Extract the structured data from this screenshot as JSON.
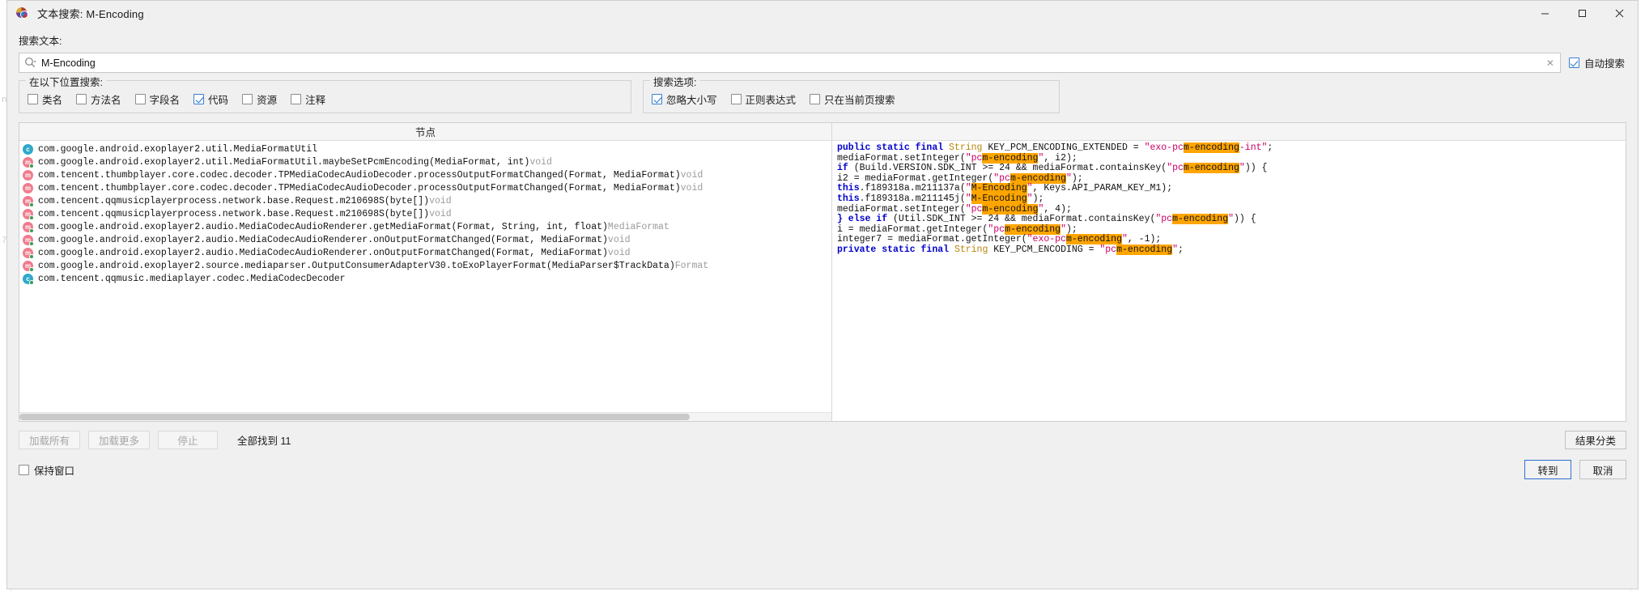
{
  "window": {
    "title": "文本搜索: M-Encoding",
    "icon": "jadx-app-icon",
    "controls": {
      "minimize": "minimize-icon",
      "maximize": "maximize-icon",
      "close": "close-icon"
    }
  },
  "search": {
    "label": "搜索文本:",
    "value": "M-Encoding",
    "icon": "search-icon",
    "clear_icon": "clear-icon",
    "auto_search_label": "自动搜索",
    "auto_search_checked": true
  },
  "locations": {
    "legend": "在以下位置搜索:",
    "items": [
      {
        "label": "类名",
        "checked": false
      },
      {
        "label": "方法名",
        "checked": false
      },
      {
        "label": "字段名",
        "checked": false
      },
      {
        "label": "代码",
        "checked": true
      },
      {
        "label": "资源",
        "checked": false
      },
      {
        "label": "注释",
        "checked": false
      }
    ]
  },
  "options": {
    "legend": "搜索选项:",
    "items": [
      {
        "label": "忽略大小写",
        "checked": true
      },
      {
        "label": "正则表达式",
        "checked": false
      },
      {
        "label": "只在当前页搜索",
        "checked": false
      }
    ]
  },
  "results": {
    "node_column_header": "节点",
    "code_column_header": "",
    "rows": [
      {
        "icon": "class-icon",
        "kind": "class",
        "badge": "none",
        "text": "com.google.android.exoplayer2.util.MediaFormatUtil",
        "ret": ""
      },
      {
        "icon": "method-icon",
        "kind": "method",
        "badge": "green",
        "text": "com.google.android.exoplayer2.util.MediaFormatUtil.maybeSetPcmEncoding(MediaFormat, int)",
        "ret": "void"
      },
      {
        "icon": "method-icon",
        "kind": "method",
        "badge": "none",
        "text": "com.tencent.thumbplayer.core.codec.decoder.TPMediaCodecAudioDecoder.processOutputFormatChanged(Format, MediaFormat)",
        "ret": "void"
      },
      {
        "icon": "method-icon",
        "kind": "method",
        "badge": "none",
        "text": "com.tencent.thumbplayer.core.codec.decoder.TPMediaCodecAudioDecoder.processOutputFormatChanged(Format, MediaFormat)",
        "ret": "void"
      },
      {
        "icon": "method-icon",
        "kind": "method",
        "badge": "green",
        "text": "com.tencent.qqmusicplayerprocess.network.base.Request.m210698S(byte[])",
        "ret": "void"
      },
      {
        "icon": "method-icon",
        "kind": "method",
        "badge": "green",
        "text": "com.tencent.qqmusicplayerprocess.network.base.Request.m210698S(byte[])",
        "ret": "void"
      },
      {
        "icon": "method-icon",
        "kind": "method",
        "badge": "green",
        "text": "com.google.android.exoplayer2.audio.MediaCodecAudioRenderer.getMediaFormat(Format, String, int, float)",
        "ret": "MediaFormat"
      },
      {
        "icon": "method-icon",
        "kind": "method",
        "badge": "green",
        "text": "com.google.android.exoplayer2.audio.MediaCodecAudioRenderer.onOutputFormatChanged(Format, MediaFormat)",
        "ret": "void"
      },
      {
        "icon": "method-icon",
        "kind": "method",
        "badge": "green",
        "text": "com.google.android.exoplayer2.audio.MediaCodecAudioRenderer.onOutputFormatChanged(Format, MediaFormat)",
        "ret": "void"
      },
      {
        "icon": "method-icon",
        "kind": "method",
        "badge": "green",
        "text": "com.google.android.exoplayer2.source.mediaparser.OutputConsumerAdapterV30.toExoPlayerFormat(MediaParser$TrackData)",
        "ret": "Format"
      },
      {
        "icon": "class-icon",
        "kind": "class",
        "badge": "green",
        "text": "com.tencent.qqmusic.mediaplayer.codec.MediaCodecDecoder",
        "ret": ""
      }
    ],
    "code_lines": [
      [
        {
          "t": "public static final ",
          "c": "kw"
        },
        {
          "t": "String ",
          "c": "typ"
        },
        {
          "t": "KEY_PCM_ENCODING_EXTENDED = ",
          "c": "pln"
        },
        {
          "t": "\"exo-pc",
          "c": "str"
        },
        {
          "t": "m-encoding",
          "c": "hl"
        },
        {
          "t": "-int\"",
          "c": "str"
        },
        {
          "t": ";",
          "c": "pln"
        }
      ],
      [
        {
          "t": "mediaFormat.setInteger(",
          "c": "pln"
        },
        {
          "t": "\"pc",
          "c": "str"
        },
        {
          "t": "m-encoding",
          "c": "hl"
        },
        {
          "t": "\"",
          "c": "str"
        },
        {
          "t": ", i2);",
          "c": "pln"
        }
      ],
      [
        {
          "t": "if ",
          "c": "kw"
        },
        {
          "t": "(Build.VERSION.SDK_INT >= 24 && mediaFormat.containsKey(",
          "c": "pln"
        },
        {
          "t": "\"pc",
          "c": "str"
        },
        {
          "t": "m-encoding",
          "c": "hl"
        },
        {
          "t": "\"",
          "c": "str"
        },
        {
          "t": ")) {",
          "c": "pln"
        }
      ],
      [
        {
          "t": "i2 = mediaFormat.getInteger(",
          "c": "pln"
        },
        {
          "t": "\"pc",
          "c": "str"
        },
        {
          "t": "m-encoding",
          "c": "hl"
        },
        {
          "t": "\"",
          "c": "str"
        },
        {
          "t": ");",
          "c": "pln"
        }
      ],
      [
        {
          "t": "this",
          "c": "kw"
        },
        {
          "t": ".f189318a.m211137a(",
          "c": "pln"
        },
        {
          "t": "\"",
          "c": "str"
        },
        {
          "t": "M-Encoding",
          "c": "hl"
        },
        {
          "t": "\"",
          "c": "str"
        },
        {
          "t": ", Keys.API_PARAM_KEY_M1);",
          "c": "pln"
        }
      ],
      [
        {
          "t": "this",
          "c": "kw"
        },
        {
          "t": ".f189318a.m211145j(",
          "c": "pln"
        },
        {
          "t": "\"",
          "c": "str"
        },
        {
          "t": "M-Encoding",
          "c": "hl"
        },
        {
          "t": "\"",
          "c": "str"
        },
        {
          "t": ");",
          "c": "pln"
        }
      ],
      [
        {
          "t": "mediaFormat.setInteger(",
          "c": "pln"
        },
        {
          "t": "\"pc",
          "c": "str"
        },
        {
          "t": "m-encoding",
          "c": "hl"
        },
        {
          "t": "\"",
          "c": "str"
        },
        {
          "t": ", 4);",
          "c": "pln"
        }
      ],
      [
        {
          "t": "} else if ",
          "c": "kw"
        },
        {
          "t": "(Util.SDK_INT >= 24 && mediaFormat.containsKey(",
          "c": "pln"
        },
        {
          "t": "\"pc",
          "c": "str"
        },
        {
          "t": "m-encoding",
          "c": "hl"
        },
        {
          "t": "\"",
          "c": "str"
        },
        {
          "t": ")) {",
          "c": "pln"
        }
      ],
      [
        {
          "t": "i = mediaFormat.getInteger(",
          "c": "pln"
        },
        {
          "t": "\"pc",
          "c": "str"
        },
        {
          "t": "m-encoding",
          "c": "hl"
        },
        {
          "t": "\"",
          "c": "str"
        },
        {
          "t": ");",
          "c": "pln"
        }
      ],
      [
        {
          "t": "integer7 = mediaFormat.getInteger(",
          "c": "pln"
        },
        {
          "t": "\"exo-pc",
          "c": "str"
        },
        {
          "t": "m-encoding",
          "c": "hl"
        },
        {
          "t": "\"",
          "c": "str"
        },
        {
          "t": ", -1);",
          "c": "pln"
        }
      ],
      [
        {
          "t": "private static final ",
          "c": "kw"
        },
        {
          "t": "String ",
          "c": "typ"
        },
        {
          "t": "KEY_PCM_ENCODING = ",
          "c": "pln"
        },
        {
          "t": "\"pc",
          "c": "str"
        },
        {
          "t": "m-encoding",
          "c": "hl"
        },
        {
          "t": "\"",
          "c": "str"
        },
        {
          "t": ";",
          "c": "pln"
        }
      ]
    ]
  },
  "footer": {
    "load_all_label": "加载所有",
    "load_more_label": "加载更多",
    "stop_label": "停止",
    "found_label": "全部找到",
    "found_count": "11",
    "classify_label": "结果分类",
    "keep_window_label": "保持窗口",
    "keep_window_checked": false,
    "goto_label": "转到",
    "cancel_label": "取消"
  },
  "colors": {
    "accent": "#3a7fd5",
    "highlight": "#ffa500",
    "keyword": "#0000cc",
    "string": "#cc0066",
    "type": "#b8860b"
  }
}
